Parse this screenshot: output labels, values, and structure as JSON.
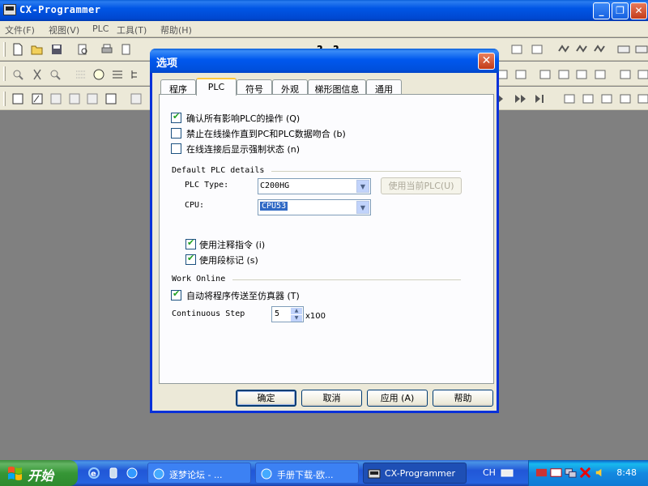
{
  "app": {
    "title": "CX-Programmer",
    "menu": [
      "文件(F)",
      "视图(V)",
      "PLC",
      "工具(T)",
      "帮助(H)"
    ]
  },
  "dialog": {
    "title": "选项",
    "tabs": [
      "程序",
      "PLC",
      "符号",
      "外观",
      "梯形图信息",
      "通用"
    ],
    "active_tab": "PLC",
    "options": [
      {
        "label": "确认所有影响PLC的操作 (Q)",
        "checked": true
      },
      {
        "label": "禁止在线操作直到PC和PLC数据吻合 (b)",
        "checked": false
      },
      {
        "label": "在线连接后显示强制状态 (n)",
        "checked": false
      }
    ],
    "default_plc": {
      "group_title": "Default PLC details",
      "plc_type_label": "PLC Type:",
      "plc_type_value": "C200HG",
      "use_current_btn": "使用当前PLC(U)",
      "cpu_label": "CPU:",
      "cpu_value": "CPU53"
    },
    "sub_options": [
      {
        "label": "使用注释指令 (i)",
        "checked": true
      },
      {
        "label": "使用段标记 (s)",
        "checked": true
      }
    ],
    "work_online": {
      "group_title": "Work Online",
      "option": {
        "label": "自动将程序传送至仿真器 (T)",
        "checked": true
      }
    },
    "continuous_step": {
      "label": "Continuous Step",
      "value": "5",
      "unit": "x100"
    },
    "buttons": {
      "ok": "确定",
      "cancel": "取消",
      "apply": "应用 (A)",
      "help": "帮助"
    }
  },
  "taskbar": {
    "start": "开始",
    "tasks": [
      "逐梦论坛 - ...",
      "手册下载-欧...",
      "CX-Programmer"
    ],
    "language": "CH",
    "clock": "8:48"
  }
}
